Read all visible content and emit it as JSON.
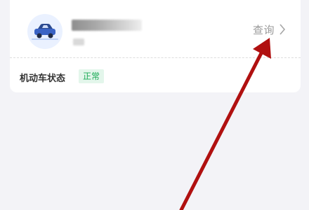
{
  "vehicle_card": {
    "icon": "car-icon",
    "query_label": "查询",
    "chevron_icon": "chevron-right-icon"
  },
  "status": {
    "label": "机动车状态",
    "badge": "正常"
  },
  "annotation": {
    "color": "#b01010",
    "icon": "pointer-arrow"
  }
}
